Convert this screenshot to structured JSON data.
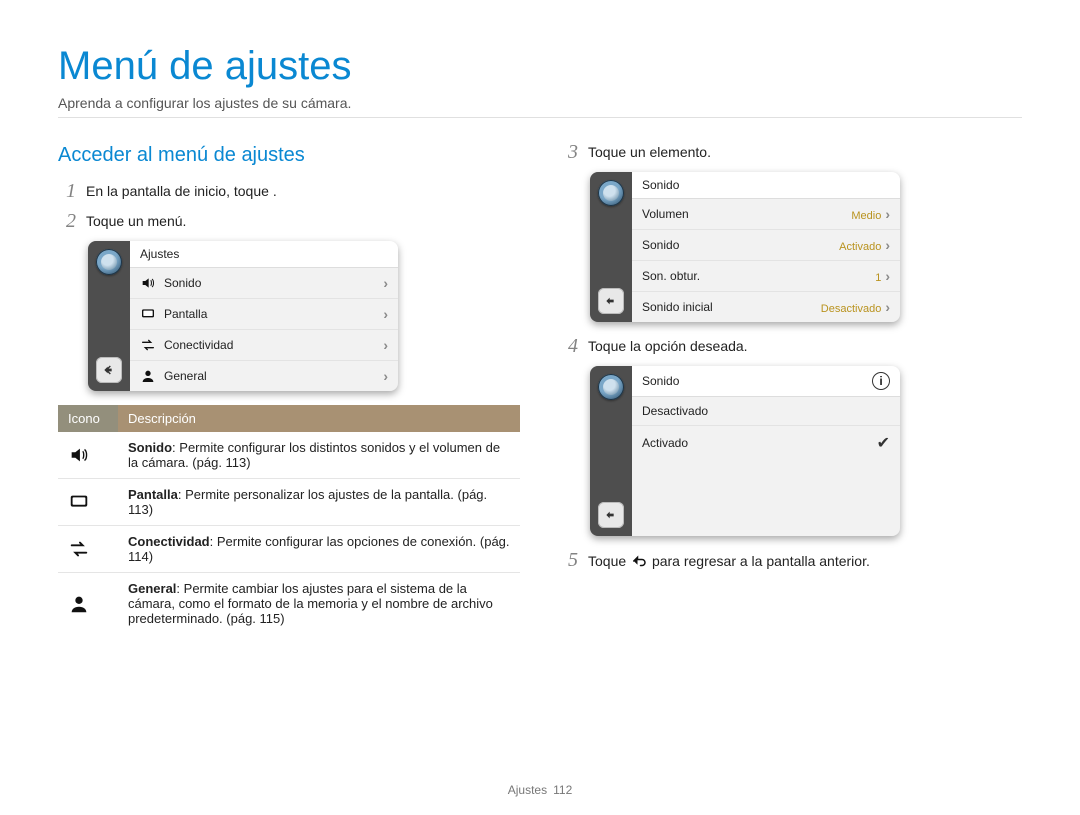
{
  "title": "Menú de ajustes",
  "subtitle": "Aprenda a configurar los ajustes de su cámara.",
  "section_heading": "Acceder al menú de ajustes",
  "steps": {
    "s1_text": "En la pantalla de inicio, toque ",
    "s1_after": ".",
    "s2_text": "Toque un menú.",
    "s3_text": "Toque un elemento.",
    "s4_text": "Toque la opción deseada.",
    "s5_before": "Toque ",
    "s5_after": " para regresar a la pantalla anterior."
  },
  "screen1": {
    "header": "Ajustes",
    "rows": [
      {
        "label": "Sonido"
      },
      {
        "label": "Pantalla"
      },
      {
        "label": "Conectividad"
      },
      {
        "label": "General"
      }
    ]
  },
  "screen2": {
    "header": "Sonido",
    "rows": [
      {
        "label": "Volumen",
        "value": "Medio"
      },
      {
        "label": "Sonido",
        "value": "Activado"
      },
      {
        "label": "Son. obtur.",
        "value": "1"
      },
      {
        "label": "Sonido inicial",
        "value": "Desactivado"
      }
    ]
  },
  "screen3": {
    "header": "Sonido",
    "options": [
      {
        "label": "Desactivado",
        "selected": false
      },
      {
        "label": "Activado",
        "selected": true
      }
    ]
  },
  "icon_table": {
    "col_icon": "Icono",
    "col_desc": "Descripción",
    "rows": [
      {
        "title": "Sonido",
        "desc": ": Permite configurar los distintos sonidos y el volumen de la cámara. (pág. 113)"
      },
      {
        "title": "Pantalla",
        "desc": ": Permite personalizar los ajustes de la pantalla. (pág. 113)"
      },
      {
        "title": "Conectividad",
        "desc": ": Permite configurar las opciones de conexión. (pág. 114)"
      },
      {
        "title": "General",
        "desc": ": Permite cambiar los ajustes para el sistema de la cámara, como el formato de la memoria y el nombre de archivo predeterminado. (pág. 115)"
      }
    ]
  },
  "footer": {
    "label": "Ajustes",
    "page": "112"
  }
}
